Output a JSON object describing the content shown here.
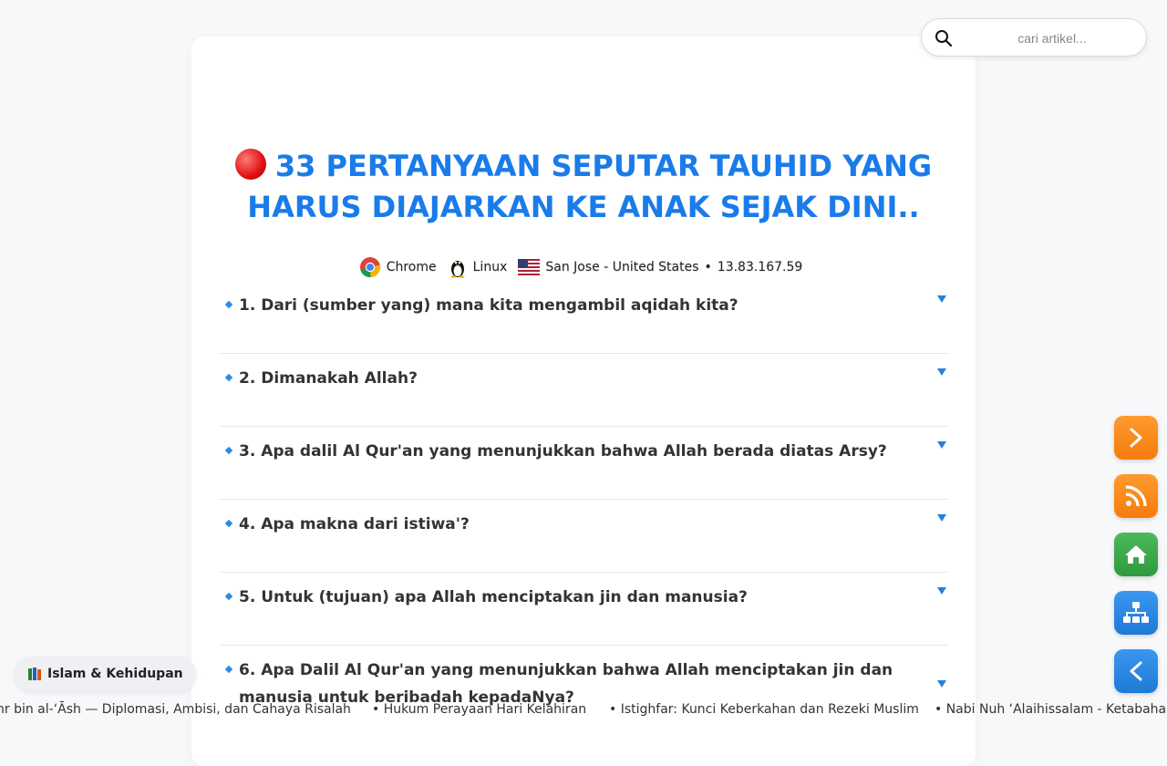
{
  "search": {
    "placeholder": "cari artikel..."
  },
  "article": {
    "title": "33 PERTANYAAN SEPUTAR TAUHID YANG HARUS DIAJARKAN KE ANAK SEJAK DINI.."
  },
  "visitor": {
    "browser": "Chrome",
    "os": "Linux",
    "location": "San Jose - United States",
    "separator": "•",
    "ip": "13.83.167.59"
  },
  "faq": [
    {
      "question": "1. Dari (sumber yang) mana kita mengambil aqidah kita?"
    },
    {
      "question": "2. Dimanakah Allah?"
    },
    {
      "question": "3. Apa dalil Al Qur'an yang menunjukkan bahwa Allah berada diatas Arsy?"
    },
    {
      "question": "4. Apa makna dari istiwa'?"
    },
    {
      "question": "5. Untuk (tujuan) apa Allah menciptakan jin dan manusia?"
    },
    {
      "question": "6. Apa Dalil Al Qur'an yang menunjukkan bahwa Allah menciptakan jin dan manusia untuk beribadah kepadaNya?"
    }
  ],
  "category_pill": {
    "icon": "books-icon",
    "label": "Islam & Kehidupan"
  },
  "ticker": [
    "nr bin al-‘Āsh — Diplomasi, Ambisi, dan Cahaya Risalah",
    "• Hukum Perayaan Hari Kelahiran",
    "• Istighfar: Kunci Keberkahan dan Rezeki Muslim",
    "• Nabi Nuh ‘Alaihissalam - Ketabahan"
  ],
  "side_buttons": [
    {
      "icon": "chevron-right-icon",
      "color": "#f7931e"
    },
    {
      "icon": "rss-icon",
      "color": "#f7931e"
    },
    {
      "icon": "home-icon",
      "color": "#3fa34d"
    },
    {
      "icon": "sitemap-icon",
      "color": "#2b8be6"
    },
    {
      "icon": "chevron-left-icon",
      "color": "#2b8be6"
    }
  ],
  "colors": {
    "title": "#1a7bea",
    "accent": "#2a8be8"
  }
}
